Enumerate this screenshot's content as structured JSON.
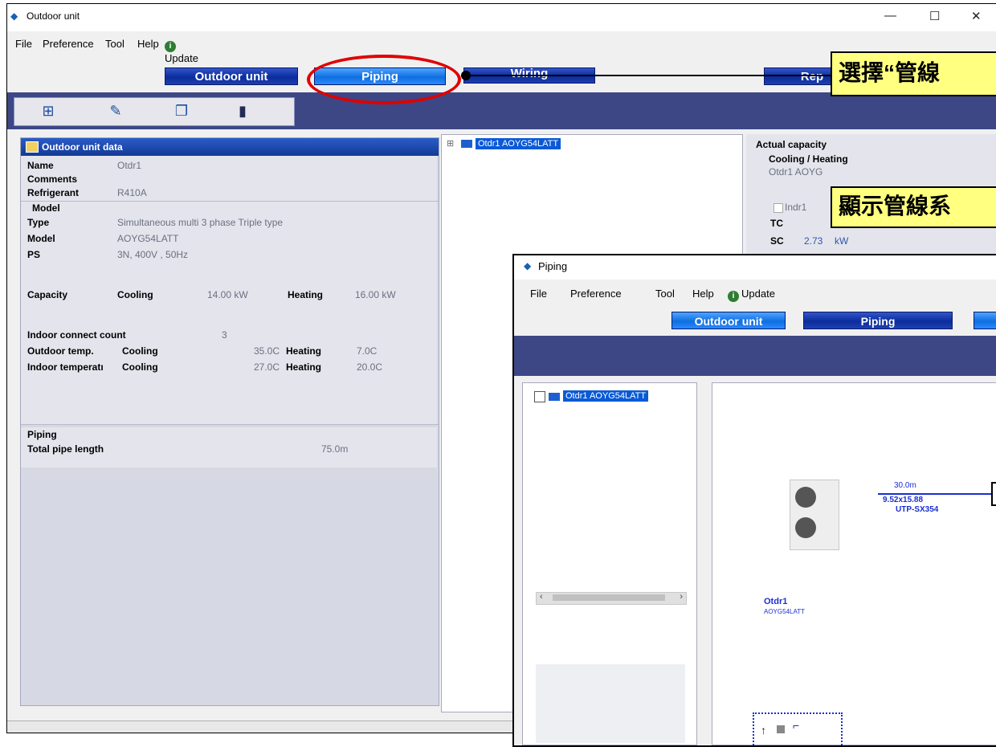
{
  "main_window": {
    "title": "Outdoor unit",
    "controls": {
      "minimize": "—",
      "maximize": "☐",
      "close": "✕"
    },
    "menu": [
      "File",
      "Preference",
      "Tool",
      "Help",
      "Update"
    ],
    "tabs": {
      "outdoor_unit": "Outdoor unit",
      "piping": "Piping",
      "wiring": "Wiring",
      "report": "Rep"
    },
    "toolbar_icons": [
      "add-unit-icon",
      "edit-icon",
      "copy-icon",
      "delete-icon"
    ]
  },
  "outdoor_unit_data": {
    "header": "Outdoor unit data",
    "name_label": "Name",
    "name_value": "Otdr1",
    "comments_label": "Comments",
    "refrigerant_label": "Refrigerant",
    "refrigerant_value": "R410A",
    "model_section": "Model",
    "type_label": "Type",
    "type_value": "Simultaneous multi 3 phase Triple type",
    "model_label": "Model",
    "model_value": "AOYG54LATT",
    "ps_label": "PS",
    "ps_value": "3N, 400V , 50Hz",
    "capacity_label": "Capacity",
    "cooling_label": "Cooling",
    "cooling_value": "14.00 kW",
    "heating_label": "Heating",
    "heating_value": "16.00 kW",
    "indoor_count_label": "Indoor connect count",
    "indoor_count_value": "3",
    "outdoor_temp_label": "Outdoor temp.",
    "outdoor_temp_cooling_label": "Cooling",
    "outdoor_temp_cooling": "35.0C",
    "outdoor_temp_heating_label": "Heating",
    "outdoor_temp_heating": "7.0C",
    "indoor_temp_label": "Indoor temperatı",
    "indoor_temp_cooling_label": "Cooling",
    "indoor_temp_cooling": "27.0C",
    "indoor_temp_heating_label": "Heating",
    "indoor_temp_heating": "20.0C",
    "piping_section": "Piping",
    "total_pipe_label": "Total pipe length",
    "total_pipe_value": "75.0m"
  },
  "tree": {
    "node": "Otdr1  AOYG54LATT",
    "expander": "⊞"
  },
  "actual_capacity": {
    "title": "Actual capacity",
    "subtitle": "Cooling / Heating",
    "row1": "Otdr1  AOYG",
    "indoor": "Indr1",
    "tc_label": "TC",
    "sc_label": "SC",
    "sc_value": "2.73",
    "sc_unit": "kW"
  },
  "piping_window": {
    "title": "Piping",
    "menu": [
      "File",
      "Preference",
      "Tool",
      "Help",
      "Update"
    ],
    "tabs": {
      "outdoor_unit": "Outdoor unit",
      "piping": "Piping"
    },
    "tree_node": "Otdr1  AOYG54LATT",
    "pipe_length": "30.0m",
    "pipe_size": "9.52x15.88",
    "pipe_model": "UTP-SX354",
    "unit_name": "Otdr1",
    "unit_model": "AOYG54LATT"
  },
  "callouts": {
    "select_piping": "選擇“管線",
    "show_piping": "顯示管線系"
  },
  "colors": {
    "toolbar": "#3d4786",
    "callout": "#ffff80",
    "highlight_ellipse": "#e00000",
    "pipe_line": "#1a2fd0"
  }
}
